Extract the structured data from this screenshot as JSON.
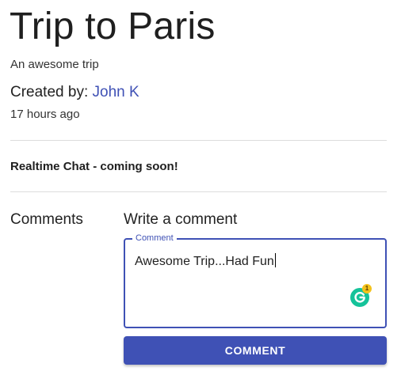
{
  "trip": {
    "title": "Trip to Paris",
    "description": "An awesome trip",
    "created_by_prefix": "Created by:",
    "creator_name": "John K",
    "time_ago": "17 hours ago"
  },
  "chat": {
    "notice": "Realtime Chat - coming soon!"
  },
  "comments": {
    "section_label": "Comments",
    "write_label": "Write a comment",
    "field_label": "Comment",
    "field_value": "Awesome Trip...Had Fun",
    "submit_label": "Comment"
  },
  "grammarly": {
    "icon": "grammarly-icon",
    "badge_count": "1",
    "color": "#15c39a"
  },
  "colors": {
    "accent": "#3f51b5"
  }
}
